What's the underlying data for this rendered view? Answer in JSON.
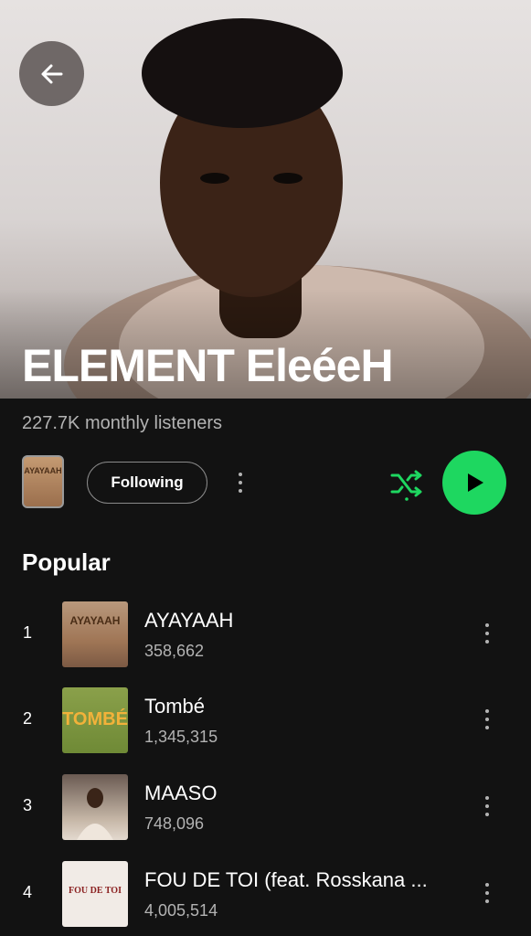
{
  "artist": {
    "name": "ELEMENT EleéeH",
    "monthly_listeners": "227.7K monthly listeners"
  },
  "header": {
    "back_icon": "arrow-left-icon"
  },
  "actions": {
    "following_label": "Following",
    "more_icon": "more-vertical-icon",
    "shuffle_icon": "shuffle-icon",
    "play_icon": "play-icon",
    "album_thumb_text": "AYAYAAH",
    "accent_color": "#1ed760"
  },
  "popular": {
    "title": "Popular",
    "tracks": [
      {
        "rank": "1",
        "title": "AYAYAAH",
        "plays": "358,662",
        "art_text": "AYAYAAH"
      },
      {
        "rank": "2",
        "title": "Tombé",
        "plays": "1,345,315",
        "art_text": "TOMBÉ"
      },
      {
        "rank": "3",
        "title": "MAASO",
        "plays": "748,096",
        "art_text": ""
      },
      {
        "rank": "4",
        "title": "FOU DE TOI (feat. Rosskana ...",
        "plays": "4,005,514",
        "art_text": "FOU DE TOI"
      }
    ]
  }
}
